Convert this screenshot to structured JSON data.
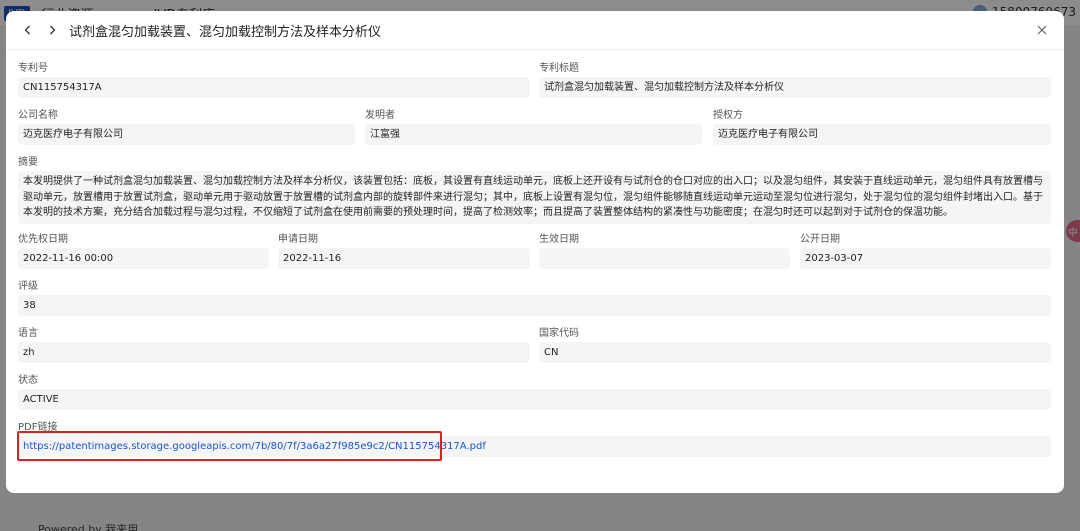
{
  "background": {
    "logo": "IVD",
    "tab": "行业资源",
    "menu": "IVD专利库",
    "phone": "15800769673",
    "footer": "Powered by 我来用"
  },
  "modal": {
    "title": "试剂盒混匀加载装置、混匀加载控制方法及样本分析仪",
    "fields": {
      "patent_no": {
        "label": "专利号",
        "value": "CN115754317A"
      },
      "patent_title": {
        "label": "专利标题",
        "value": "试剂盒混匀加载装置、混匀加载控制方法及样本分析仪"
      },
      "company": {
        "label": "公司名称",
        "value": "迈克医疗电子有限公司"
      },
      "inventor": {
        "label": "发明者",
        "value": "江富强"
      },
      "assignee": {
        "label": "授权方",
        "value": "迈克医疗电子有限公司"
      },
      "abstract": {
        "label": "摘要",
        "value": "本发明提供了一种试剂盒混匀加载装置、混匀加载控制方法及样本分析仪，该装置包括：底板，其设置有直线运动单元，底板上还开设有与试剂仓的仓口对应的出入口；以及混匀组件，其安装于直线运动单元，混匀组件具有放置槽与驱动单元，放置槽用于放置试剂盒，驱动单元用于驱动放置于放置槽的试剂盒内部的旋转部件来进行混匀；其中，底板上设置有混匀位，混匀组件能够随直线运动单元运动至混匀位进行混匀，处于混匀位的混匀组件封堵出入口。基于本发明的技术方案，充分结合加载过程与混匀过程，不仅缩短了试剂盒在使用前需要的预处理时间，提高了检测效率；而且提高了装置整体结构的紧凑性与功能密度；在混匀时还可以起到对于试剂仓的保温功能。"
      },
      "priority_date": {
        "label": "优先权日期",
        "value": "2022-11-16 00:00"
      },
      "application_date": {
        "label": "申请日期",
        "value": "2022-11-16"
      },
      "effective_date": {
        "label": "生效日期",
        "value": ""
      },
      "publication_date": {
        "label": "公开日期",
        "value": "2023-03-07"
      },
      "rating": {
        "label": "评级",
        "value": "38"
      },
      "language": {
        "label": "语言",
        "value": "zh"
      },
      "country_code": {
        "label": "国家代码",
        "value": "CN"
      },
      "status": {
        "label": "状态",
        "value": "ACTIVE"
      },
      "pdf_link": {
        "label": "PDF链接",
        "value": "https://patentimages.storage.googleapis.com/7b/80/7f/3a6a27f985e9c2/CN115754317A.pdf"
      }
    }
  },
  "icons": {
    "back": "chevron-left-icon",
    "forward": "chevron-right-icon",
    "close": "close-icon"
  },
  "colors": {
    "link": "#1a55c9",
    "highlight": "#e02020",
    "field_bg": "#f4f5f7"
  }
}
